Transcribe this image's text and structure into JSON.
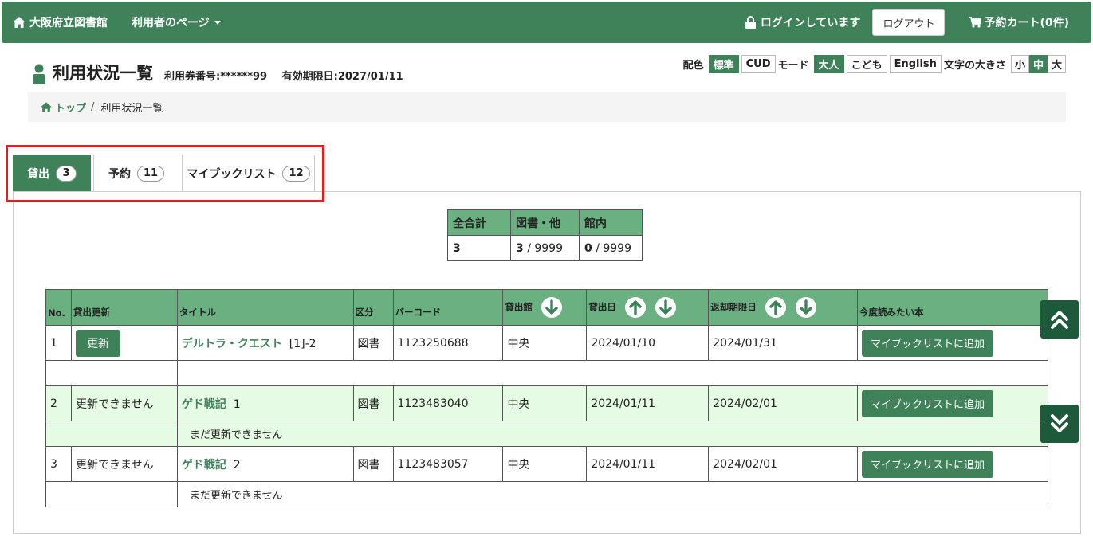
{
  "nav": {
    "brand": "大阪府立図書館",
    "user_menu": "利用者のページ",
    "login_status": "ログインしています",
    "logout": "ログアウト",
    "cart": "予約カート(0件)"
  },
  "header": {
    "title": "利用状況一覧",
    "card_number": "利用券番号:******99",
    "expiry": "有効期限日:2027/01/11"
  },
  "settings": {
    "color_label": "配色",
    "color_options": [
      "標準",
      "CUD"
    ],
    "mode_label": "モード",
    "mode_options": [
      "大人",
      "こども",
      "English"
    ],
    "size_label": "文字の大きさ",
    "size_options": [
      "小",
      "中",
      "大"
    ]
  },
  "breadcrumb": {
    "home": "トップ",
    "current": "利用状況一覧"
  },
  "tabs": [
    {
      "label": "貸出",
      "count": "3"
    },
    {
      "label": "予約",
      "count": "11"
    },
    {
      "label": "マイブックリスト",
      "count": "12"
    }
  ],
  "summary": {
    "headers": [
      "全合計",
      "図書・他",
      "館内"
    ],
    "total": "3",
    "books_count": "3",
    "books_limit": "/ 9999",
    "inhouse_count": "0",
    "inhouse_limit": "/ 9999"
  },
  "loans": {
    "headers": [
      "No.",
      "貸出更新",
      "タイトル",
      "区分",
      "バーコード",
      "貸出館",
      "貸出日",
      "返却期限日",
      "今度読みたい本"
    ],
    "rows": [
      {
        "no": "1",
        "renew": "更新",
        "title": "デルトラ・クエスト",
        "vol": "[1]-2",
        "type": "図書",
        "barcode": "1123250688",
        "library": "中央",
        "loan_date": "2024/01/10",
        "due_date": "2024/01/31",
        "add": "マイブックリストに追加",
        "note": ""
      },
      {
        "no": "2",
        "renew": "更新できません",
        "title": "ゲド戦記",
        "vol": "1",
        "type": "図書",
        "barcode": "1123483040",
        "library": "中央",
        "loan_date": "2024/01/11",
        "due_date": "2024/02/01",
        "add": "マイブックリストに追加",
        "note": "まだ更新できません"
      },
      {
        "no": "3",
        "renew": "更新できません",
        "title": "ゲド戦記",
        "vol": "2",
        "type": "図書",
        "barcode": "1123483057",
        "library": "中央",
        "loan_date": "2024/01/11",
        "due_date": "2024/02/01",
        "add": "マイブックリストに追加",
        "note": "まだ更新できません"
      }
    ]
  },
  "colors": {
    "primary": "#3f825a",
    "header_cell": "#6ab080",
    "alt_row": "#e6fbe3",
    "scroll_button": "#1d5a3c",
    "highlight": "#e02020"
  }
}
